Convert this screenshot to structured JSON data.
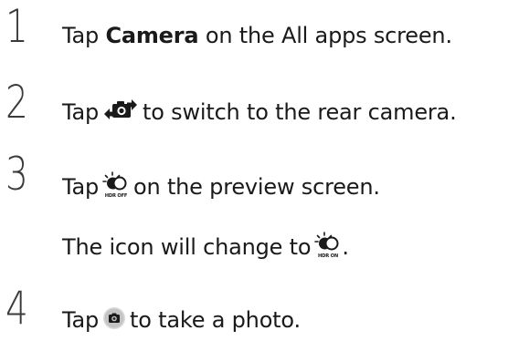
{
  "steps": [
    {
      "number": "1",
      "pre": "Tap ",
      "bold": "Camera",
      "post": " on the All apps screen."
    },
    {
      "number": "2",
      "pre": "Tap",
      "icon": "switch-camera-icon",
      "post": "to switch to the rear camera."
    },
    {
      "number": "3",
      "pre": "Tap",
      "icon": "hdr-off-icon",
      "icon_label": "HDR OFF",
      "post": "on the preview screen.",
      "note_pre": "The icon will change to",
      "note_icon": "hdr-on-icon",
      "note_icon_label": "HDR ON",
      "note_post": "."
    },
    {
      "number": "4",
      "pre": "Tap",
      "icon": "shutter-icon",
      "post": "to take a photo."
    }
  ]
}
